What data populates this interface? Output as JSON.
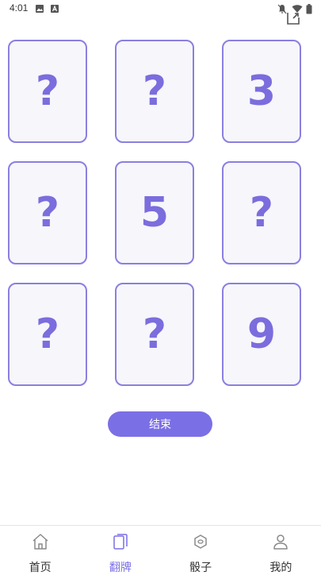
{
  "status_bar": {
    "time": "4:01",
    "left_icons": [
      "image-icon",
      "a-box-icon"
    ],
    "right_icons": [
      "notifications-off-icon",
      "wifi-icon",
      "battery-icon"
    ]
  },
  "cards": [
    {
      "label": "?"
    },
    {
      "label": "?"
    },
    {
      "label": "3"
    },
    {
      "label": "?"
    },
    {
      "label": "5"
    },
    {
      "label": "?"
    },
    {
      "label": "?"
    },
    {
      "label": "?"
    },
    {
      "label": "9"
    }
  ],
  "end_button": {
    "label": "结束"
  },
  "bottom_nav": {
    "items": [
      {
        "label": "首页",
        "icon": "home-icon",
        "active": false
      },
      {
        "label": "翻牌",
        "icon": "cards-icon",
        "active": true
      },
      {
        "label": "骰子",
        "icon": "dice-icon",
        "active": false
      },
      {
        "label": "我的",
        "icon": "user-icon",
        "active": false
      }
    ]
  },
  "colors": {
    "accent": "#7b6fe6",
    "card_border": "#8a7fe0",
    "card_bg": "#f6f6fb",
    "card_text": "#7b6ddd"
  }
}
